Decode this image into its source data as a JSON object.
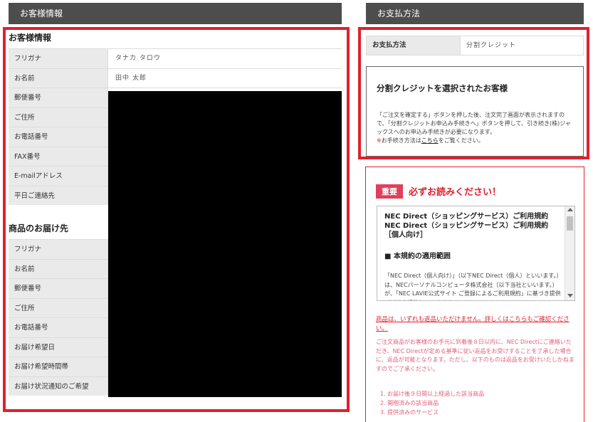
{
  "customer_section": {
    "header": "お客様情報",
    "title": "お客様情報",
    "rows": [
      {
        "label": "フリガナ",
        "value": "タナカ タロウ"
      },
      {
        "label": "お名前",
        "value": "田中 太郎"
      },
      {
        "label": "郵便番号",
        "value": ""
      },
      {
        "label": "ご住所",
        "value": ""
      },
      {
        "label": "お電話番号",
        "value": ""
      },
      {
        "label": "FAX番号",
        "value": ""
      },
      {
        "label": "E-mailアドレス",
        "value": ""
      },
      {
        "label": "平日ご連絡先",
        "value": ""
      }
    ]
  },
  "shipping_section": {
    "title": "商品のお届け先",
    "rows": [
      {
        "label": "フリガナ"
      },
      {
        "label": "お名前"
      },
      {
        "label": "郵便番号"
      },
      {
        "label": "ご住所"
      },
      {
        "label": "お電話番号"
      },
      {
        "label": "お届け希望日"
      },
      {
        "label": "お届け希望時間帯"
      },
      {
        "label": "お届け状況通知のご希望"
      }
    ]
  },
  "payment_section": {
    "header": "お支払方法",
    "label": "お支払方法",
    "value": "分割クレジット",
    "credit_box": {
      "title": "分割クレジットを選択されたお客様",
      "text": "「ご注文を確定する」ボタンを押した後、注文完了画面が表示されますので、「分割クレジットお申込み手続きへ」ボタンを押して、引き続き(株)ジャックスへのお申込み手続きが必要になります。",
      "note_mark": "※",
      "note_text": "お手続き方法は",
      "note_link": "こちら",
      "note_end": "をご覧ください。"
    }
  },
  "important": {
    "badge": "重要",
    "heading": "必ずお読みください！",
    "terms_title_1": "NEC Direct（ショッピングサービス）ご利用規約",
    "terms_title_2": "NEC Direct（ショッピングサービス）ご利用規約［個人向け］",
    "terms_section": "■ 本規約の適用範囲",
    "terms_para": "「NEC Direct（個人向け）」（以下NEC Direct（個人）といいます。）は、NECパーソナルコンピュータ株式会社（以下当社といいます。）が、「NEC LAVIE公式サイト ご登録によるご利用規約」に基づき提供（以下本規約といいます。）",
    "return_link": "商品は、いずれも返品いただけません。詳しくはこちらもご確認ください。",
    "return_text": "ご注文商品がお客様のお手元に到着後８日以内に、NEC Directにご連絡いただき、NEC Directが定める基準に従い返品をお受けすることを了承した場合に、返品が可能となります。ただし、以下のものは返品をお受けいたしかねますのでご了承ください。",
    "return_items": [
      "1. お届け後９日間以上経過した該当商品",
      "2. 開梱済みの該当商品",
      "3. 提供済みのサービス"
    ]
  },
  "colors": {
    "header_bg": "#4d4d4d",
    "accent_red": "#e0202e",
    "label_bg": "#eaeaea"
  }
}
